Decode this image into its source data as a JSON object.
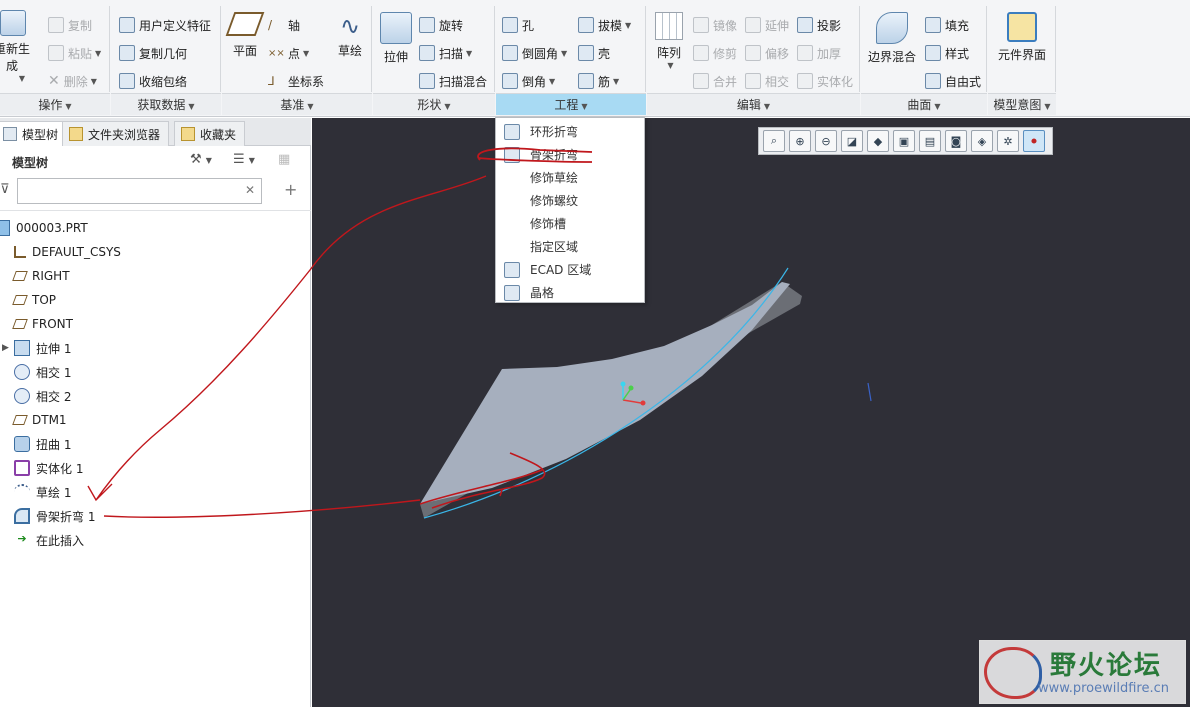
{
  "ribbon": {
    "groups": [
      {
        "label": "操作"
      },
      {
        "label": "获取数据"
      },
      {
        "label": "基准"
      },
      {
        "label": "形状"
      },
      {
        "label": "工程"
      },
      {
        "label": "编辑"
      },
      {
        "label": "曲面"
      },
      {
        "label": "模型意图"
      }
    ],
    "operations": {
      "regen": "重新生成",
      "copy": "复制",
      "paste": "粘贴",
      "delete": "删除"
    },
    "get_data": {
      "udf": "用户定义特征",
      "copy_geom": "复制几何",
      "shrinkwrap": "收缩包络"
    },
    "datum": {
      "plane": "平面",
      "axis": "轴",
      "point": "点",
      "csys": "坐标系",
      "sketch": "草绘"
    },
    "shape": {
      "extrude": "拉伸",
      "revolve": "旋转",
      "sweep": "扫描",
      "swept_blend": "扫描混合"
    },
    "engineering": {
      "hole": "孔",
      "draft": "拔模",
      "round": "倒圆角",
      "shell": "壳",
      "chamfer": "倒角",
      "rib": "筋"
    },
    "edit": {
      "pattern": "阵列",
      "mirror": "镜像",
      "extend": "延伸",
      "project": "投影",
      "trim": "修剪",
      "offset": "偏移",
      "thicken": "加厚",
      "merge": "合并",
      "intersect": "相交",
      "solidify": "实体化"
    },
    "surfaces": {
      "boundary_blend": "边界混合",
      "fill": "填充",
      "style": "样式",
      "freestyle": "自由式"
    },
    "model_intent": {
      "component_interface": "元件界面"
    }
  },
  "engineering_menu": {
    "items": [
      {
        "label": "环形折弯",
        "icon": "toroidal-bend-icon"
      },
      {
        "label": "骨架折弯",
        "icon": "spinal-bend-icon"
      },
      {
        "label": "修饰草绘",
        "icon": ""
      },
      {
        "label": "修饰螺纹",
        "icon": ""
      },
      {
        "label": "修饰槽",
        "icon": ""
      },
      {
        "label": "指定区域",
        "icon": ""
      },
      {
        "label": "ECAD 区域",
        "icon": "ecad-area-icon"
      },
      {
        "label": "晶格",
        "icon": "lattice-icon"
      }
    ]
  },
  "left_panel": {
    "tabs": [
      "模型树",
      "文件夹浏览器",
      "收藏夹"
    ],
    "title": "模型树",
    "search_placeholder": "",
    "tree": [
      {
        "label": "000003.PRT",
        "icon": "part-icon"
      },
      {
        "label": "DEFAULT_CSYS",
        "icon": "csys-icon"
      },
      {
        "label": "RIGHT",
        "icon": "datum-plane-icon"
      },
      {
        "label": "TOP",
        "icon": "datum-plane-icon"
      },
      {
        "label": "FRONT",
        "icon": "datum-plane-icon"
      },
      {
        "label": "拉伸 1",
        "icon": "extrude-icon"
      },
      {
        "label": "相交 1",
        "icon": "intersect-icon"
      },
      {
        "label": "相交 2",
        "icon": "intersect-icon"
      },
      {
        "label": "DTM1",
        "icon": "datum-plane-icon"
      },
      {
        "label": "扭曲 1",
        "icon": "warp-icon"
      },
      {
        "label": "实体化 1",
        "icon": "solidify-icon"
      },
      {
        "label": "草绘 1",
        "icon": "sketch-icon"
      },
      {
        "label": "骨架折弯 1",
        "icon": "spinal-bend-icon"
      },
      {
        "label": "在此插入",
        "icon": "insert-here-arrow-icon"
      }
    ]
  },
  "watermark": {
    "title": "野火论坛",
    "url": "www.proewildfire.cn"
  },
  "colors": {
    "viewport_bg": "#2f2f37",
    "part_top": "#a6afbe",
    "part_side": "#6b6e75",
    "active_group": "#a8daf3",
    "annotation": "#c0171c"
  }
}
